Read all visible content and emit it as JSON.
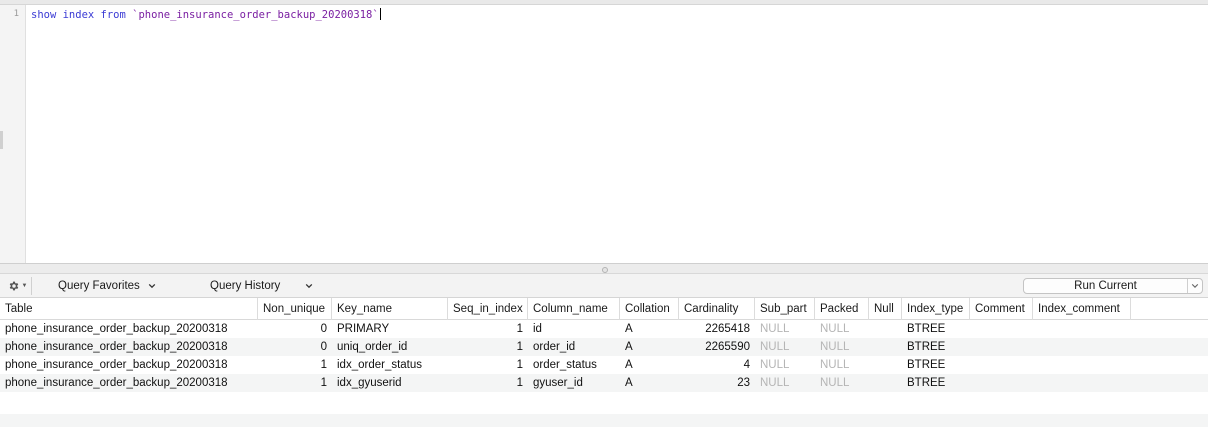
{
  "editor": {
    "line_number": "1",
    "code_keyword": "show index from",
    "code_table": "`phone_insurance_order_backup_20200318`"
  },
  "toolbar": {
    "gear_icon": "gear-icon",
    "query_favorites": "Query Favorites",
    "query_history": "Query History",
    "run_current": "Run Current"
  },
  "results": {
    "columns": [
      "Table",
      "Non_unique",
      "Key_name",
      "Seq_in_index",
      "Column_name",
      "Collation",
      "Cardinality",
      "Sub_part",
      "Packed",
      "Null",
      "Index_type",
      "Comment",
      "Index_comment"
    ],
    "rows": [
      [
        "phone_insurance_order_backup_20200318",
        "0",
        "PRIMARY",
        "1",
        "id",
        "A",
        "2265418",
        "NULL",
        "NULL",
        "",
        "BTREE",
        "",
        ""
      ],
      [
        "phone_insurance_order_backup_20200318",
        "0",
        "uniq_order_id",
        "1",
        "order_id",
        "A",
        "2265590",
        "NULL",
        "NULL",
        "",
        "BTREE",
        "",
        ""
      ],
      [
        "phone_insurance_order_backup_20200318",
        "1",
        "idx_order_status",
        "1",
        "order_status",
        "A",
        "4",
        "NULL",
        "NULL",
        "",
        "BTREE",
        "",
        ""
      ],
      [
        "phone_insurance_order_backup_20200318",
        "1",
        "idx_gyuserid",
        "1",
        "gyuser_id",
        "A",
        "23",
        "NULL",
        "NULL",
        "",
        "BTREE",
        "",
        ""
      ]
    ]
  }
}
